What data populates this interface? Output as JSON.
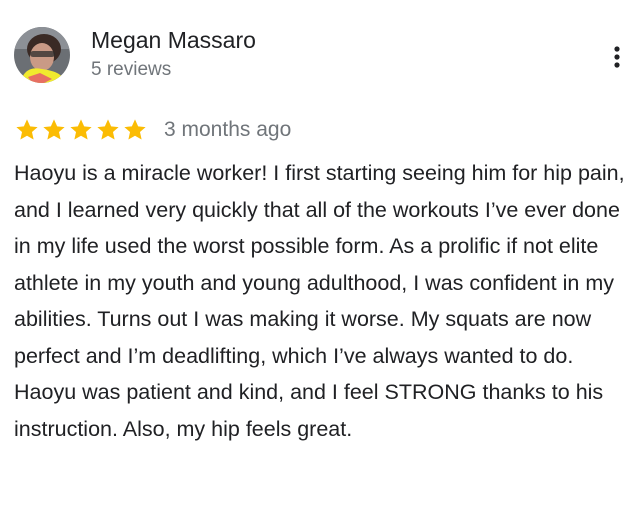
{
  "review": {
    "author": {
      "name": "Megan Massaro",
      "review_count": "5 reviews",
      "avatar_icon": "person-avatar-icon"
    },
    "menu_icon": "more-vert-icon",
    "rating": 5,
    "rating_max": 5,
    "star_color": "#fbbc04",
    "date": "3 months ago",
    "text": "Haoyu is a miracle worker! I first starting seeing him for hip pain, and I learned very quickly that all of the workouts I’ve ever done in my life used the worst possible form. As a prolific if not elite athlete in my youth and young adulthood, I was confident in my abilities. Turns out I was making it worse. My squats are now perfect and I’m deadlifting, which I’ve always wanted to do. Haoyu was patient and kind, and I feel STRONG thanks to his instruction. Also, my hip feels great."
  }
}
